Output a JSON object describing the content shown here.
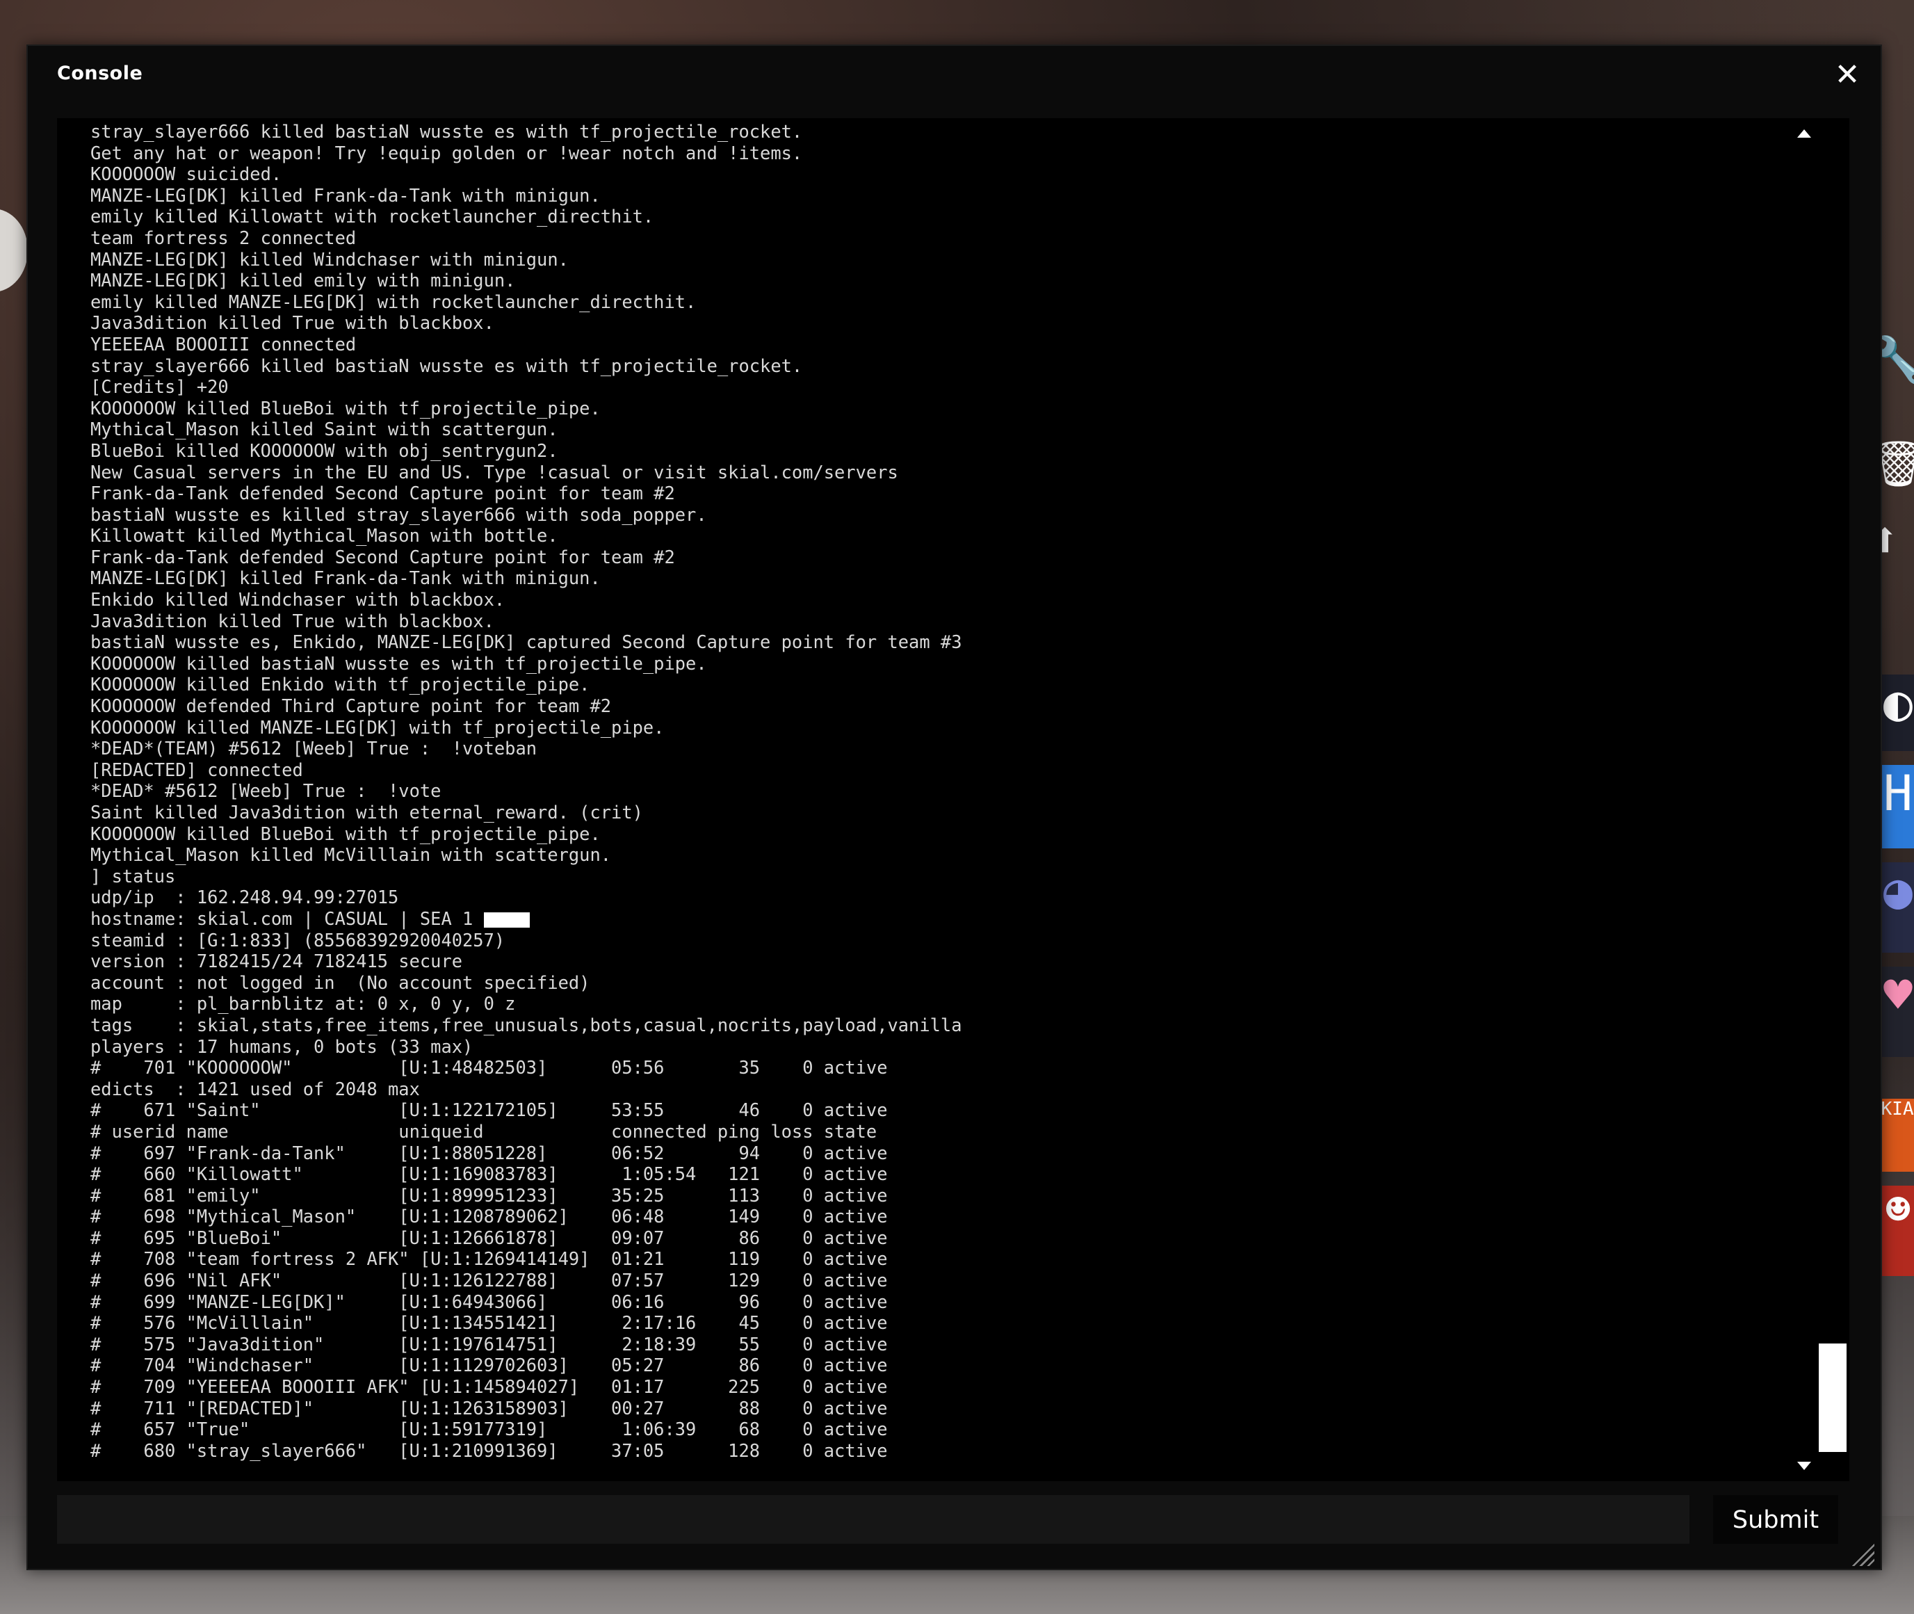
{
  "window": {
    "title": "Console",
    "close_glyph": "✕"
  },
  "log_lines": [
    "stray_slayer666 killed bastiaN wusste es with tf_projectile_rocket.",
    "Get any hat or weapon! Try !equip golden or !wear notch and !items.",
    "KOOOOOOW suicided.",
    "MANZE-LEG[DK] killed Frank-da-Tank with minigun.",
    "emily killed Killowatt with rocketlauncher_directhit.",
    "team fortress 2 connected",
    "MANZE-LEG[DK] killed Windchaser with minigun.",
    "MANZE-LEG[DK] killed emily with minigun.",
    "emily killed MANZE-LEG[DK] with rocketlauncher_directhit.",
    "Java3dition killed True with blackbox.",
    "YEEEEAA BOOOIII connected",
    "stray_slayer666 killed bastiaN wusste es with tf_projectile_rocket.",
    "[Credits] +20",
    "KOOOOOOW killed BlueBoi with tf_projectile_pipe.",
    "Mythical_Mason killed Saint with scattergun.",
    "BlueBoi killed KOOOOOOW with obj_sentrygun2.",
    "New Casual servers in the EU and US. Type !casual or visit skial.com/servers",
    "Frank-da-Tank defended Second Capture point for team #2",
    "bastiaN wusste es killed stray_slayer666 with soda_popper.",
    "Killowatt killed Mythical_Mason with bottle.",
    "Frank-da-Tank defended Second Capture point for team #2",
    "MANZE-LEG[DK] killed Frank-da-Tank with minigun.",
    "Enkido killed Windchaser with blackbox.",
    "Java3dition killed True with blackbox.",
    "bastiaN wusste es, Enkido, MANZE-LEG[DK] captured Second Capture point for team #3",
    "KOOOOOOW killed bastiaN wusste es with tf_projectile_pipe.",
    "KOOOOOOW killed Enkido with tf_projectile_pipe.",
    "KOOOOOOW defended Third Capture point for team #2",
    "KOOOOOOW killed MANZE-LEG[DK] with tf_projectile_pipe.",
    "*DEAD*(TEAM) #5612 [Weeb] True :  !voteban",
    "[REDACTED] connected",
    "*DEAD* #5612 [Weeb] True :  !vote",
    "Saint killed Java3dition with eternal_reward. (crit)",
    "KOOOOOOW killed BlueBoi with tf_projectile_pipe.",
    "Mythical_Mason killed McVilllain with scattergun.",
    "] status",
    "udp/ip  : 162.248.94.99:27015",
    "hostname: skial.com | CASUAL | SEA 1 ",
    "steamid : [G:1:833] (85568392920040257)",
    "version : 7182415/24 7182415 secure",
    "account : not logged in  (No account specified)",
    "map     : pl_barnblitz at: 0 x, 0 y, 0 z",
    "tags    : skial,stats,free_items,free_unusuals,bots,casual,nocrits,payload,vanilla",
    "players : 17 humans, 0 bots (33 max)",
    "#    701 \"KOOOOOOW\"          [U:1:48482503]      05:56       35    0 active",
    "edicts  : 1421 used of 2048 max",
    "#    671 \"Saint\"             [U:1:122172105]     53:55       46    0 active",
    "# userid name                uniqueid            connected ping loss state",
    "#    697 \"Frank-da-Tank\"     [U:1:88051228]      06:52       94    0 active",
    "#    660 \"Killowatt\"         [U:1:169083783]      1:05:54   121    0 active",
    "#    681 \"emily\"             [U:1:899951233]     35:25      113    0 active",
    "#    698 \"Mythical_Mason\"    [U:1:1208789062]    06:48      149    0 active",
    "#    695 \"BlueBoi\"           [U:1:126661878]     09:07       86    0 active",
    "#    708 \"team fortress 2 AFK\" [U:1:1269414149]  01:21      119    0 active",
    "#    696 \"Nil AFK\"           [U:1:126122788]     07:57      129    0 active",
    "#    699 \"MANZE-LEG[DK]\"     [U:1:64943066]      06:16       96    0 active",
    "#    576 \"McVilllain\"        [U:1:134551421]      2:17:16    45    0 active",
    "#    575 \"Java3dition\"       [U:1:197614751]      2:18:39    55    0 active",
    "#    704 \"Windchaser\"        [U:1:1129702603]    05:27       86    0 active",
    "#    709 \"YEEEEAA BOOOIII AFK\" [U:1:145894027]   01:17      225    0 active",
    "#    711 \"[REDACTED]\"        [U:1:1263158903]    00:27       88    0 active",
    "#    657 \"True\"              [U:1:59177319]       1:06:39    68    0 active",
    "#    680 \"stray_slayer666\"   [U:1:210991369]     37:05      128    0 active"
  ],
  "input": {
    "value": "",
    "placeholder": ""
  },
  "submit_label": "Submit",
  "icons": {
    "close": "close-icon",
    "scroll_up": "scroll-up-arrow-icon",
    "scroll_down": "scroll-down-arrow-icon",
    "resize": "resize-grip-icon"
  },
  "hud_icons": {
    "orange_badge_text": "SKIAL.TF"
  },
  "colors": {
    "window_bg": "#0b0b0b",
    "log_bg": "#000000",
    "log_text": "#d9d9d9",
    "input_bg": "#161616",
    "accent_white": "#ffffff"
  }
}
